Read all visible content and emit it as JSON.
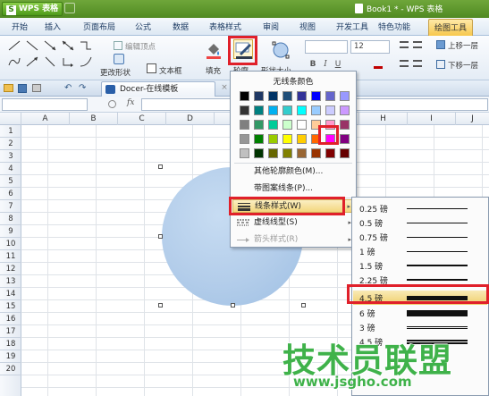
{
  "app": {
    "name": "WPS 表格",
    "logo_letter": "S",
    "document_title": "Book1 * - WPS 表格"
  },
  "menu_tabs": [
    "开始",
    "插入",
    "页面布局",
    "公式",
    "数据",
    "表格样式",
    "审阅",
    "视图",
    "开发工具",
    "特色功能",
    "绘图工具"
  ],
  "active_tab": "绘图工具",
  "ribbon": {
    "edit_vertex": "编辑顶点",
    "change_shape": "更改形状",
    "text_box": "文本框",
    "fill": "填充",
    "outline": "轮廓",
    "shape_size": "形状大小",
    "font_size": "12",
    "bring_forward": "上移一层",
    "send_backward": "下移一层",
    "bold": "B",
    "italic": "I",
    "underline": "U"
  },
  "doc_tab": {
    "label": "Docer-在线模板",
    "close": "×"
  },
  "formula_bar": {
    "fx": "fx"
  },
  "columns": [
    "A",
    "B",
    "C",
    "D",
    "E",
    "F",
    "G",
    "H",
    "I",
    "J"
  ],
  "rows": [
    "1",
    "2",
    "3",
    "4",
    "5",
    "6",
    "7",
    "8",
    "9",
    "10",
    "11",
    "12",
    "13",
    "14",
    "15",
    "16",
    "17",
    "18",
    "19",
    "20"
  ],
  "color_popup": {
    "no_line": "无线条颜色",
    "swatch_colors": [
      [
        "#000000",
        "#1f3864",
        "#003366",
        "#1f4e79",
        "#333399",
        "#0000ff",
        "#6666cc",
        "#9999ff"
      ],
      [
        "#333333",
        "#008080",
        "#00b0f0",
        "#33cccc",
        "#00ffff",
        "#99ccff",
        "#ccccff",
        "#cc99ff"
      ],
      [
        "#808080",
        "#339966",
        "#00cc99",
        "#ccffcc",
        "#ffffff",
        "#ffcc99",
        "#ff99cc",
        "#993366"
      ],
      [
        "#969696",
        "#008000",
        "#99cc00",
        "#ffff00",
        "#ffcc00",
        "#ff6600",
        "#ff00ff",
        "#800080"
      ],
      [
        "#c0c0c0",
        "#003300",
        "#666600",
        "#808000",
        "#996633",
        "#993300",
        "#800000",
        "#660000"
      ]
    ],
    "items": [
      {
        "label": "其他轮廓颜色(M)...",
        "disabled": false,
        "submenu": false
      },
      {
        "label": "带图案线条(P)...",
        "disabled": false,
        "submenu": false
      },
      {
        "label": "线条样式(W)",
        "disabled": false,
        "submenu": true
      },
      {
        "label": "虚线线型(S)",
        "disabled": false,
        "submenu": true
      },
      {
        "label": "箭头样式(R)",
        "disabled": true,
        "submenu": true
      }
    ]
  },
  "line_weights": [
    {
      "label": "0.25 磅",
      "pt": 0.25
    },
    {
      "label": "0.5 磅",
      "pt": 0.5
    },
    {
      "label": "0.75 磅",
      "pt": 0.75
    },
    {
      "label": "1 磅",
      "pt": 1
    },
    {
      "label": "1.5 磅",
      "pt": 1.5
    },
    {
      "label": "2.25 磅",
      "pt": 2.25
    },
    {
      "label": "3 磅",
      "pt": 3
    },
    {
      "label": "4.5 磅",
      "pt": 4.5
    },
    {
      "label": "6 磅",
      "pt": 6
    },
    {
      "label": "3 磅",
      "pt": 3
    },
    {
      "label": "4.5 磅",
      "pt": 4.5
    },
    {
      "label": "6 磅",
      "pt": 6
    }
  ],
  "selected_line_weight": "4.5 磅",
  "watermark": {
    "text": "技术员联盟",
    "url": "www.jsgho.com"
  },
  "colors": {
    "title_green": "#5a9a2a",
    "highlight_red": "#e0202a",
    "shape_fill": "#b3cdea",
    "watermark_green": "#3fb24a"
  }
}
